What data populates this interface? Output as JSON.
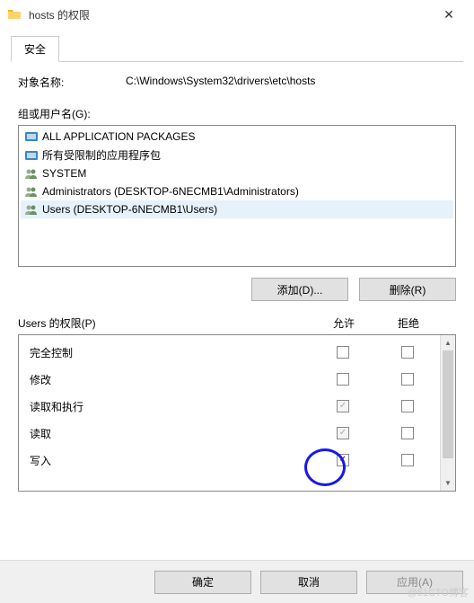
{
  "titlebar": {
    "title": "hosts 的权限"
  },
  "tab": {
    "security": "安全"
  },
  "object": {
    "label": "对象名称:",
    "value": "C:\\Windows\\System32\\drivers\\etc\\hosts"
  },
  "groups": {
    "label": "组或用户名(G):",
    "items": [
      {
        "name": "ALL APPLICATION PACKAGES",
        "iconColor": "#3a86c8"
      },
      {
        "name": "所有受限制的应用程序包",
        "iconColor": "#3a86c8"
      },
      {
        "name": "SYSTEM",
        "iconColor": "#94b08a"
      },
      {
        "name": "Administrators (DESKTOP-6NECMB1\\Administrators)",
        "iconColor": "#94b08a"
      },
      {
        "name": "Users (DESKTOP-6NECMB1\\Users)",
        "iconColor": "#94b08a"
      }
    ]
  },
  "buttons": {
    "add": "添加(D)...",
    "remove": "删除(R)",
    "ok": "确定",
    "cancel": "取消",
    "apply": "应用(A)"
  },
  "perms": {
    "header": "Users 的权限(P)",
    "allow": "允许",
    "deny": "拒绝",
    "rows": [
      {
        "name": "完全控制",
        "allow": false,
        "allowDisabled": false,
        "deny": false
      },
      {
        "name": "修改",
        "allow": false,
        "allowDisabled": false,
        "deny": false
      },
      {
        "name": "读取和执行",
        "allow": true,
        "allowDisabled": true,
        "deny": false
      },
      {
        "name": "读取",
        "allow": true,
        "allowDisabled": true,
        "deny": false
      },
      {
        "name": "写入",
        "allow": true,
        "allowDisabled": false,
        "deny": false
      }
    ]
  },
  "watermark": "@51CTO博客"
}
